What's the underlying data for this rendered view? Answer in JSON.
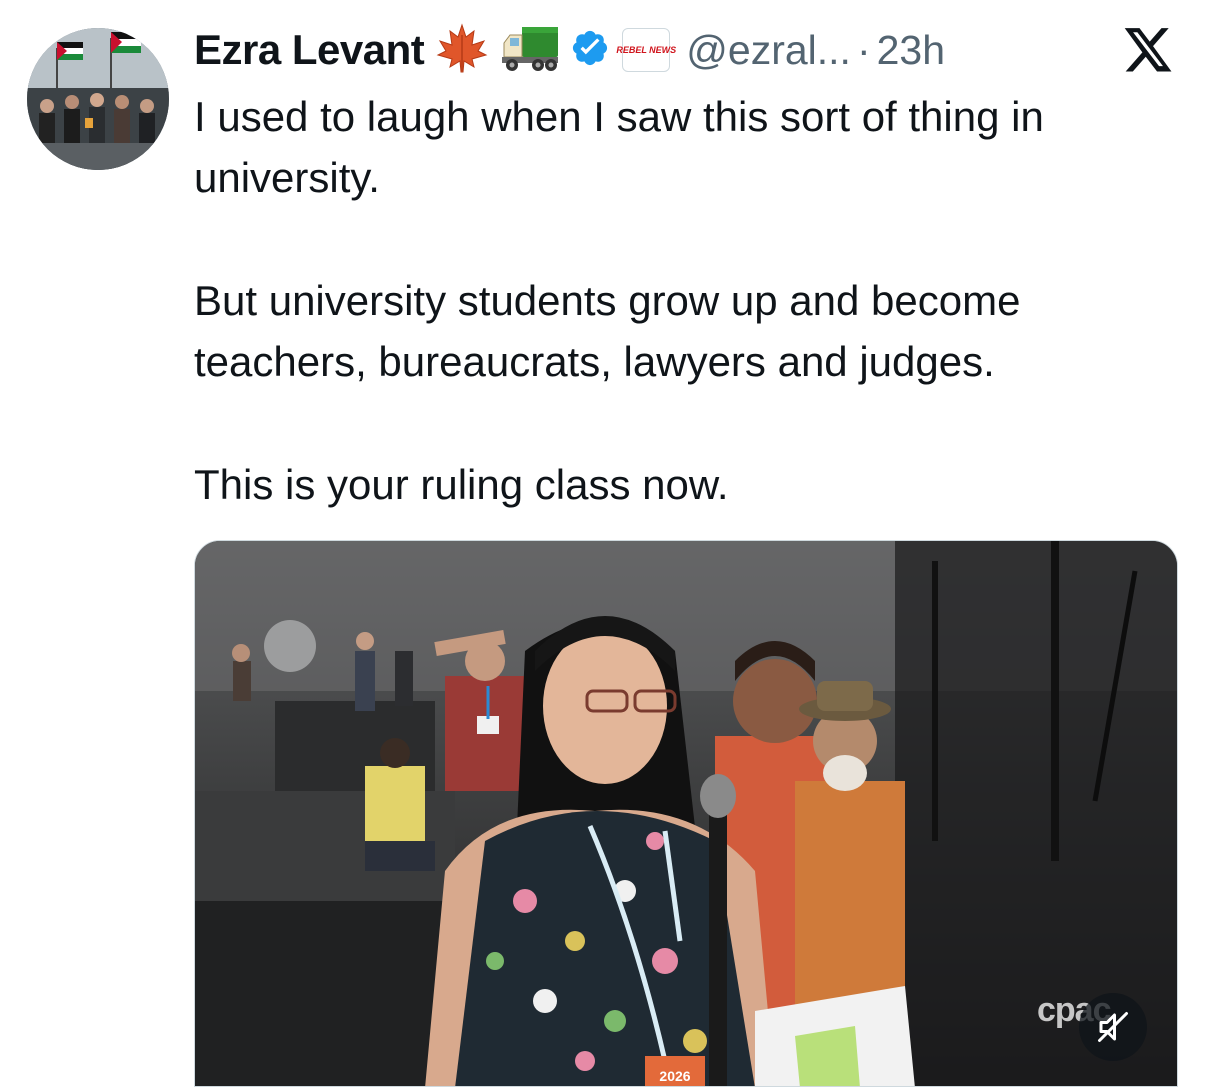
{
  "tweet": {
    "author": {
      "display_name": "Ezra Levant",
      "handle": "@ezral...",
      "emojis": [
        "maple-leaf-icon",
        "truck-icon"
      ],
      "verified": true,
      "affiliate_badge_text": "REBEL NEWS"
    },
    "separator": "·",
    "timestamp": "23h",
    "paragraphs": [
      "I used to laugh when I saw this sort of thing in university.",
      "But university students grow up and become teachers, bureaucrats, lawyers and judges.",
      "This is your ruling class now."
    ],
    "media": {
      "watermark": "cpac",
      "badge_text": "2026",
      "muted": true
    }
  },
  "colors": {
    "text_primary": "#0f1419",
    "text_secondary": "#536471",
    "verified_blue": "#1d9bf0",
    "affiliate_red": "#d0141c"
  }
}
